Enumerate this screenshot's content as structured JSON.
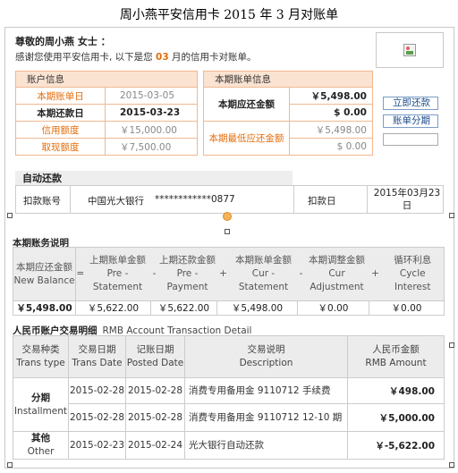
{
  "title": "周小燕平安信用卡 2015 年 3 月对账单",
  "greeting": {
    "name": "尊敬的周小燕  女士 ：",
    "line_prefix": "感谢您使用平安信用卡, 以下是您 ",
    "month": "03",
    "line_suffix": " 月的信用卡对账单。"
  },
  "logo": {
    "icon": "broken-image-icon"
  },
  "account_info": {
    "header": "账户信息",
    "rows": [
      {
        "label": "本期账单日",
        "value": "2015-03-05"
      },
      {
        "label": "本期还款日",
        "value": "2015-03-23"
      },
      {
        "label": "信用额度",
        "value": "￥15,000.00"
      },
      {
        "label": "取现额度",
        "value": "￥7,500.00"
      }
    ]
  },
  "statement_info": {
    "header": "本期账单信息",
    "due_label": "本期应还金额",
    "due_amount": "￥5,498.00",
    "due_usd": "$ 0.00",
    "min_label": "本期最低应还金额",
    "min_amount": "￥5,498.00",
    "min_usd": "$ 0.00"
  },
  "actions": {
    "pay_now": "立即还款",
    "installment": "账单分期",
    "input_value": ""
  },
  "auto_repay": {
    "header": "自动还款",
    "account_label": "扣款账号",
    "bank": "中国光大银行",
    "account_number": "************0877",
    "date_label": "扣款日",
    "date_value": "2015年03月23日"
  },
  "balance_section": {
    "title": "本期账务说明",
    "headers": [
      {
        "cn": "本期应还金额",
        "en": "New Balance"
      },
      {
        "cn": "=",
        "en": ""
      },
      {
        "cn": "上期账单金额",
        "en": "Pre - Statement"
      },
      {
        "cn": "-",
        "en": ""
      },
      {
        "cn": "上期还款金额",
        "en": "Pre - Payment"
      },
      {
        "cn": "+",
        "en": ""
      },
      {
        "cn": "本期账单金额",
        "en": "Cur - Statement"
      },
      {
        "cn": "-",
        "en": ""
      },
      {
        "cn": "本期调整金额",
        "en": "Cur Adjustment"
      },
      {
        "cn": "+",
        "en": ""
      },
      {
        "cn": "循环利息",
        "en": "Cycle Interest"
      }
    ],
    "values": [
      "￥5,498.00",
      "￥5,622.00",
      "￥5,622.00",
      "￥5,498.00",
      "￥0.00",
      "￥0.00"
    ]
  },
  "transactions": {
    "title_cn": "人民币账户交易明细",
    "title_en": "RMB Account Transaction Detail",
    "columns": [
      {
        "cn": "交易种类",
        "en": "Trans type"
      },
      {
        "cn": "交易日期",
        "en": "Trans Date"
      },
      {
        "cn": "记账日期",
        "en": "Posted Date"
      },
      {
        "cn": "交易说明",
        "en": "Description"
      },
      {
        "cn": "人民币金额",
        "en": "RMB Amount"
      }
    ],
    "groups": [
      {
        "type_cn": "分期",
        "type_en": "Installment",
        "rows": [
          {
            "trans_date": "2015-02-28",
            "posted_date": "2015-02-28",
            "desc": "消费专用备用金 9110712 手续费",
            "amount": "￥498.00"
          },
          {
            "trans_date": "2015-02-28",
            "posted_date": "2015-02-28",
            "desc": "消费专用备用金 9110712 12-10 期",
            "amount": "￥5,000.00"
          }
        ]
      },
      {
        "type_cn": "其他",
        "type_en": "Other",
        "rows": [
          {
            "trans_date": "2015-02-23",
            "posted_date": "2015-02-24",
            "desc": "光大银行自动还款",
            "amount": "￥-5,622.00"
          }
        ]
      }
    ]
  }
}
